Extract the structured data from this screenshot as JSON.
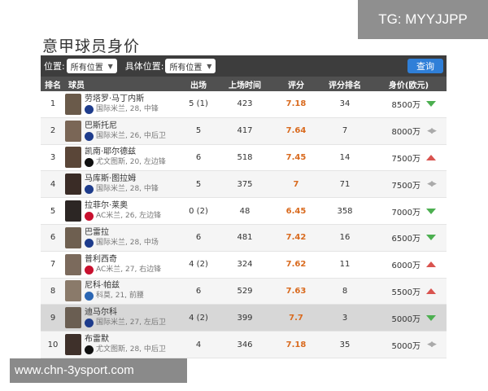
{
  "watermark_top": "TG: MYYJJPP",
  "watermark_bottom": "www.chn-3ysport.com",
  "title": "意甲球员身价",
  "filters": {
    "position_label": "位置:",
    "position_value": "所有位置",
    "specific_label": "具体位置:",
    "specific_value": "所有位置",
    "query_button": "查询"
  },
  "columns": [
    "排名",
    "球员",
    "出场",
    "上场时间",
    "评分",
    "评分排名",
    "身价(欧元)"
  ],
  "club_colors": {
    "国际米兰": "#1e3c8c",
    "尤文图斯": "#111111",
    "AC米兰": "#c8102e",
    "科莫": "#2b66b3"
  },
  "rows": [
    {
      "rank": "1",
      "name": "劳塔罗·马丁内斯",
      "meta": "国际米兰, 28, 中锋",
      "club": "国际米兰",
      "apps": "5 (1)",
      "minutes": "423",
      "rating": "7.18",
      "rating_rank": "34",
      "value": "8500万",
      "trend": "down",
      "avatar": "#6a5a4a"
    },
    {
      "rank": "2",
      "name": "巴斯托尼",
      "meta": "国际米兰, 26, 中后卫",
      "club": "国际米兰",
      "apps": "5",
      "minutes": "417",
      "rating": "7.64",
      "rating_rank": "7",
      "value": "8000万",
      "trend": "flat",
      "avatar": "#7a6656"
    },
    {
      "rank": "3",
      "name": "凯南·耶尔德兹",
      "meta": "尤文图斯, 20, 左边锋",
      "club": "尤文图斯",
      "apps": "6",
      "minutes": "518",
      "rating": "7.45",
      "rating_rank": "14",
      "value": "7500万",
      "trend": "up",
      "avatar": "#5a4638"
    },
    {
      "rank": "4",
      "name": "马库斯·图拉姆",
      "meta": "国际米兰, 28, 中锋",
      "club": "国际米兰",
      "apps": "5",
      "minutes": "375",
      "rating": "7",
      "rating_rank": "71",
      "value": "7500万",
      "trend": "flat",
      "avatar": "#3a2c26"
    },
    {
      "rank": "5",
      "name": "拉菲尔·莱奥",
      "meta": "AC米兰, 26, 左边锋",
      "club": "AC米兰",
      "apps": "0 (2)",
      "minutes": "48",
      "rating": "6.45",
      "rating_rank": "358",
      "value": "7000万",
      "trend": "down",
      "avatar": "#2c2624"
    },
    {
      "rank": "6",
      "name": "巴雷拉",
      "meta": "国际米兰, 28, 中场",
      "club": "国际米兰",
      "apps": "6",
      "minutes": "481",
      "rating": "7.42",
      "rating_rank": "16",
      "value": "6500万",
      "trend": "down",
      "avatar": "#6e5f50"
    },
    {
      "rank": "7",
      "name": "普利西奇",
      "meta": "AC米兰, 27, 右边锋",
      "club": "AC米兰",
      "apps": "4 (2)",
      "minutes": "324",
      "rating": "7.62",
      "rating_rank": "11",
      "value": "6000万",
      "trend": "up",
      "avatar": "#7b6a5c"
    },
    {
      "rank": "8",
      "name": "尼科·帕兹",
      "meta": "科莫, 21, 前腰",
      "club": "科莫",
      "apps": "6",
      "minutes": "529",
      "rating": "7.63",
      "rating_rank": "8",
      "value": "5500万",
      "trend": "up",
      "avatar": "#8a7a6a"
    },
    {
      "rank": "9",
      "name": "迪马尔科",
      "meta": "国际米兰, 27, 左后卫",
      "club": "国际米兰",
      "apps": "4 (2)",
      "minutes": "399",
      "rating": "7.7",
      "rating_rank": "3",
      "value": "5000万",
      "trend": "down",
      "avatar": "#6a5e52",
      "highlight": true
    },
    {
      "rank": "10",
      "name": "布雷默",
      "meta": "尤文图斯, 28, 中后卫",
      "club": "尤文图斯",
      "apps": "4",
      "minutes": "346",
      "rating": "7.18",
      "rating_rank": "35",
      "value": "5000万",
      "trend": "flat",
      "avatar": "#3e302a"
    }
  ]
}
